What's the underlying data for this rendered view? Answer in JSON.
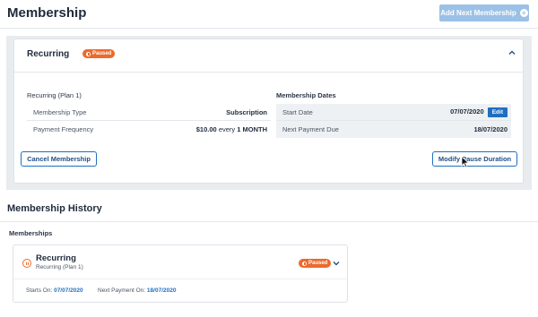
{
  "header": {
    "title": "Membership",
    "add_button": "Add Next Membership"
  },
  "current": {
    "name": "Recurring",
    "status_badge": "Paused",
    "left_section_title": "Recurring (Plan 1)",
    "membership_type_label": "Membership Type",
    "membership_type_value": "Subscription",
    "payment_frequency_label": "Payment Frequency",
    "payment_frequency_amount": "$10.00",
    "payment_frequency_every": "every",
    "payment_frequency_period": "1 MONTH",
    "right_section_title": "Membership Dates",
    "start_date_label": "Start Date",
    "start_date_value": "07/07/2020",
    "edit_button": "Edit",
    "next_payment_label": "Next Payment Due",
    "next_payment_value": "18/07/2020",
    "cancel_button": "Cancel Membership",
    "modify_button": "Modify Pause Duration"
  },
  "history": {
    "title": "Membership History",
    "subtitle": "Memberships",
    "items": [
      {
        "name": "Recurring",
        "plan": "Recurring (Plan 1)",
        "status_badge": "Paused",
        "starts_label": "Starts On:",
        "starts_value": "07/07/2020",
        "next_label": "Next Payment On:",
        "next_value": "18/07/2020"
      }
    ]
  },
  "colors": {
    "accent": "#1f6fc0",
    "paused": "#ec6a2d",
    "add_button_bg": "#9cc1e6"
  },
  "icons": [
    "plus-circle-icon",
    "pause-icon",
    "chevron-up-icon",
    "chevron-down-icon",
    "mouse-cursor-icon"
  ]
}
